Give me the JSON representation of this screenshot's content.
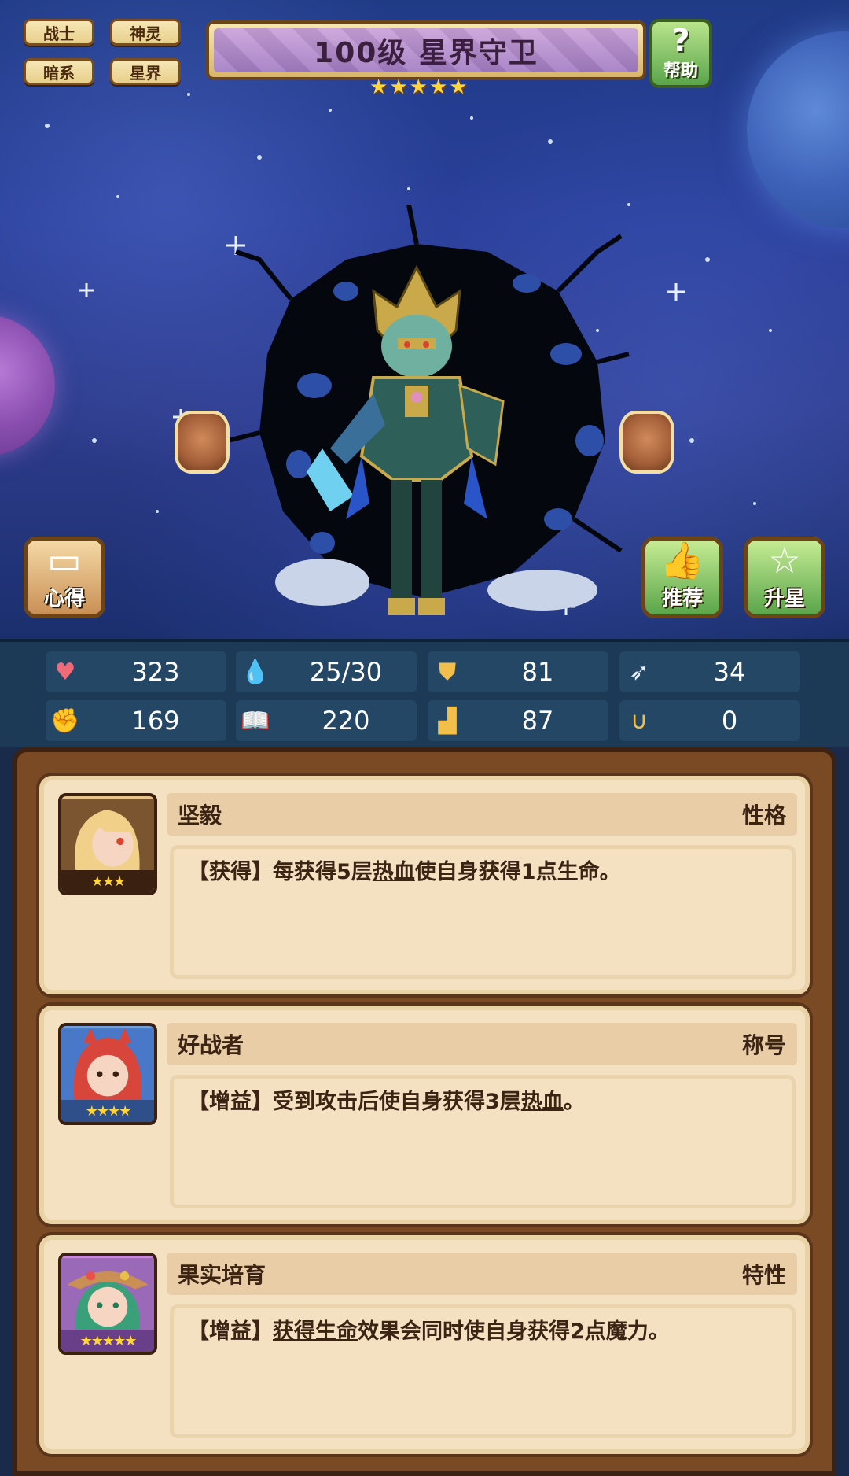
{
  "tags": [
    "战士",
    "神灵",
    "暗系",
    "星界"
  ],
  "title": "100级 星界守卫",
  "star_rating": 5,
  "help_label": "帮助",
  "buttons": {
    "left": "心得",
    "recommend": "推荐",
    "star_up": "升星"
  },
  "stats": [
    {
      "icon": "heart-icon",
      "value": "323",
      "color": "#f06a78"
    },
    {
      "icon": "drop-icon",
      "value": "25/30",
      "color": "#6fc6f0"
    },
    {
      "icon": "shield-icon",
      "value": "81",
      "color": "#f2c04a"
    },
    {
      "icon": "wing-icon",
      "value": "34",
      "color": "#e8eefa"
    },
    {
      "icon": "fist-icon",
      "value": "169",
      "color": "#e7786a"
    },
    {
      "icon": "book-icon",
      "value": "220",
      "color": "#8ec4f0"
    },
    {
      "icon": "boot-icon",
      "value": "87",
      "color": "#f2c04a"
    },
    {
      "icon": "horseshoe-icon",
      "value": "0",
      "color": "#f2c04a"
    }
  ],
  "cards": [
    {
      "name": "坚毅",
      "type": "性格",
      "stars": 3,
      "text_pre": "【获得】每获得5层",
      "text_u": "热血",
      "text_post": "使自身获得1点生命。"
    },
    {
      "name": "好战者",
      "type": "称号",
      "stars": 4,
      "text_pre": "【增益】受到攻击后使自身获得3层",
      "text_u": "热血",
      "text_post": "。"
    },
    {
      "name": "果实培育",
      "type": "特性",
      "stars": 5,
      "text_pre": "【增益】",
      "text_u": "获得生命",
      "text_post": "效果会同时使自身获得2点魔力。"
    }
  ]
}
